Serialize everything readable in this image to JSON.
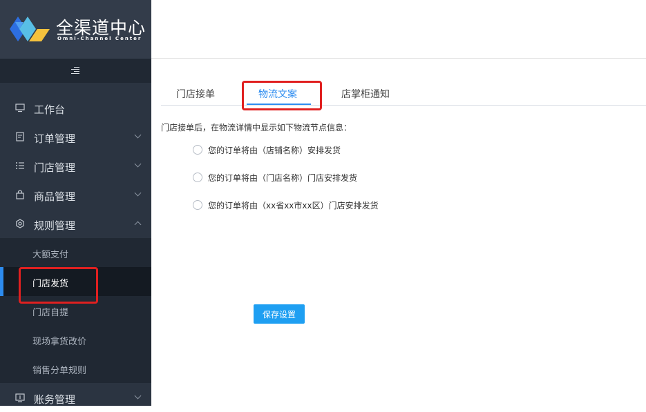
{
  "brand": {
    "title": "全渠道中心",
    "subtitle": "Omni-Channel Center",
    "logo_colors": [
      "#2d6ee0",
      "#4f9ff2",
      "#f5c23d",
      "#58bfe6"
    ]
  },
  "sidebar": {
    "collapse_icon": "collapse-menu-icon",
    "items": [
      {
        "label": "工作台",
        "icon": "monitor-icon"
      },
      {
        "label": "订单管理",
        "icon": "order-icon"
      },
      {
        "label": "门店管理",
        "icon": "list-icon"
      },
      {
        "label": "商品管理",
        "icon": "bag-icon"
      },
      {
        "label": "规则管理",
        "icon": "settings-icon"
      }
    ],
    "sub_items": [
      {
        "label": "大额支付"
      },
      {
        "label": "门店发货"
      },
      {
        "label": "门店自提"
      },
      {
        "label": "现场拿货改价"
      },
      {
        "label": "销售分单规则"
      }
    ],
    "last_item": {
      "label": "账务管理",
      "icon": "account-icon"
    }
  },
  "tabs": [
    {
      "label": "门店接单"
    },
    {
      "label": "物流文案"
    },
    {
      "label": "店掌柜通知"
    }
  ],
  "active_tab": "物流文案",
  "description": "门店接单后，在物流详情中显示如下物流节点信息：",
  "options": [
    {
      "label": "您的订单将由（店铺名称）安排发货"
    },
    {
      "label": "您的订单将由（门店名称）门店安排发货"
    },
    {
      "label": "您的订单将由（xx省xx市xx区）门店安排发货"
    }
  ],
  "save_label": "保存设置",
  "colors": {
    "accent": "#2d8cf0",
    "button": "#1e9ff2",
    "highlight": "#e02020",
    "sidebar": "#2b3441"
  }
}
